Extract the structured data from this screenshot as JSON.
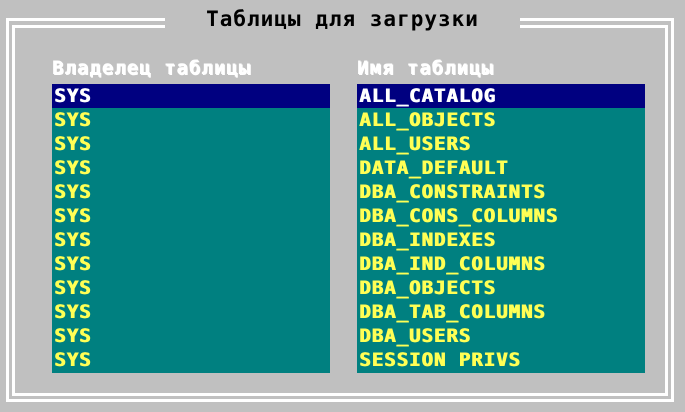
{
  "dialog": {
    "title": "Таблицы для загрузки"
  },
  "columns": {
    "owner_header": "Владелец таблицы",
    "name_header": "Имя таблицы"
  },
  "rows": [
    {
      "owner": "SYS",
      "name": "ALL_CATALOG"
    },
    {
      "owner": "SYS",
      "name": "ALL_OBJECTS"
    },
    {
      "owner": "SYS",
      "name": "ALL_USERS"
    },
    {
      "owner": "SYS",
      "name": "DATA_DEFAULT"
    },
    {
      "owner": "SYS",
      "name": "DBA_CONSTRAINTS"
    },
    {
      "owner": "SYS",
      "name": "DBA_CONS_COLUMNS"
    },
    {
      "owner": "SYS",
      "name": "DBA_INDEXES"
    },
    {
      "owner": "SYS",
      "name": "DBA_IND_COLUMNS"
    },
    {
      "owner": "SYS",
      "name": "DBA_OBJECTS"
    },
    {
      "owner": "SYS",
      "name": "DBA_TAB_COLUMNS"
    },
    {
      "owner": "SYS",
      "name": "DBA_USERS"
    },
    {
      "owner": "SYS",
      "name": "SESSION PRIVS"
    }
  ],
  "selected_index": 0,
  "colors": {
    "background": "#c0c0c0",
    "list_background": "#008080",
    "list_text": "#ffff55",
    "selection_background": "#000080",
    "selection_text": "#ffffff",
    "header_text": "#ffffff"
  }
}
